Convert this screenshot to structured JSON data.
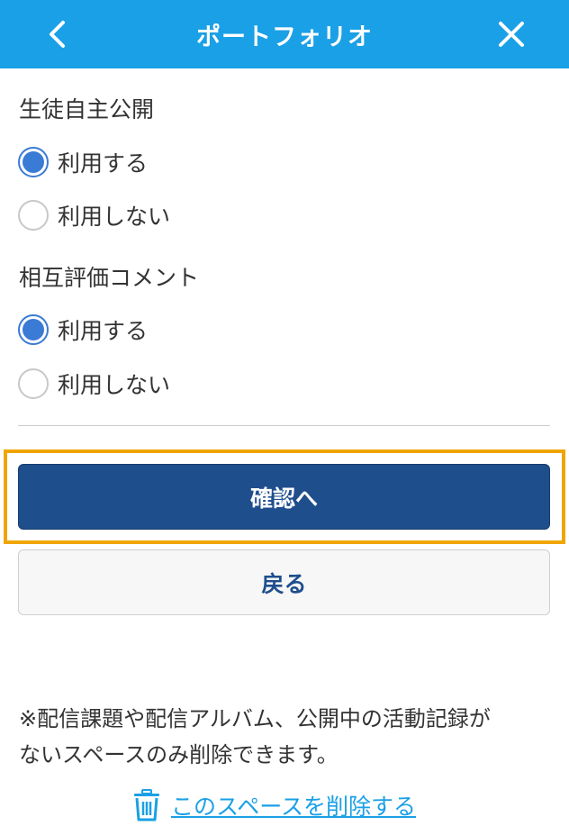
{
  "header": {
    "title": "ポートフォリオ",
    "back_icon": "chevron-left-icon",
    "close_icon": "close-icon",
    "background": "#1aa0e6"
  },
  "student_publish": {
    "label": "生徒自主公開",
    "options": [
      {
        "label": "利用する",
        "checked": true
      },
      {
        "label": "利用しない",
        "checked": false
      }
    ]
  },
  "peer_review": {
    "label": "相互評価コメント",
    "options": [
      {
        "label": "利用する",
        "checked": true
      },
      {
        "label": "利用しない",
        "checked": false
      }
    ]
  },
  "buttons": {
    "confirm": "確認へ",
    "back": "戻る"
  },
  "footer": {
    "note_line1": "※配信課題や配信アルバム、公開中の活動記録が",
    "note_line2": "ないスペースのみ削除できます。",
    "delete_link": "このスペースを削除する",
    "delete_icon": "trash-icon"
  },
  "colors": {
    "accent": "#1aa0e6",
    "primary_button": "#1f4e8c",
    "highlight": "#f0a500",
    "radio_checked": "#3a7bd5"
  }
}
